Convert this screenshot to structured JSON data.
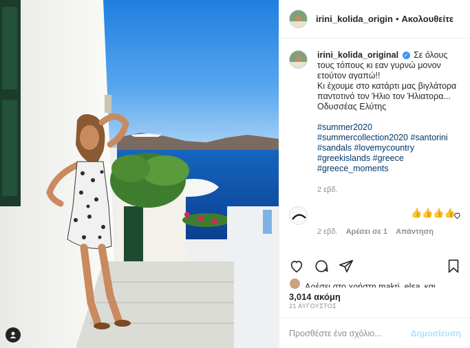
{
  "post": {
    "header": {
      "username": "irini_kolida_origin",
      "separator": "•",
      "follow_label": "Ακολουθείτε"
    },
    "caption": {
      "username": "irini_kolida_original",
      "verified_glyph": "✓",
      "lines": [
        "Σε όλους τους τόπους κι εαν γυρνώ μονον ετούτον αγαπώ!!",
        "Κι έχουμε στο κατάρτι μας βιγλάτορα παντοτινό τον Ήλιο τον Ήλιατορα...",
        "Οδυσσέας Ελύτης"
      ],
      "hashtags": [
        "#summer2020",
        "#summercollection2020",
        "#santorini",
        "#sandals",
        "#lovemycountry",
        "#greekislands",
        "#greece",
        "#greece_moments"
      ],
      "time": "2 εβδ."
    },
    "reply": {
      "text": "👍👍👍👍",
      "time": "2 εβδ.",
      "likes": "Αρέσει σε 1",
      "reply_label": "Απάντηση"
    },
    "likes": {
      "partial_text": "Αρέσει στο χρήστη makri_elsa",
      "and_label": "και",
      "count_text": "3,014 ακόμη"
    },
    "date": "21 ΑΥΓΟΥΣΤΟΣ",
    "comment_box": {
      "placeholder": "Προσθέστε ένα σχόλιο...",
      "post_label": "Δημοσίευση"
    },
    "icons": {
      "like": "heart-icon",
      "comment": "comment-icon",
      "share": "paper-plane-icon",
      "save": "bookmark-icon",
      "tags": "user-tag-icon"
    },
    "colors": {
      "link": "#00376b",
      "verified": "#3897f0",
      "post_disabled": "#b2dffc",
      "muted": "#8e8e8e"
    }
  }
}
